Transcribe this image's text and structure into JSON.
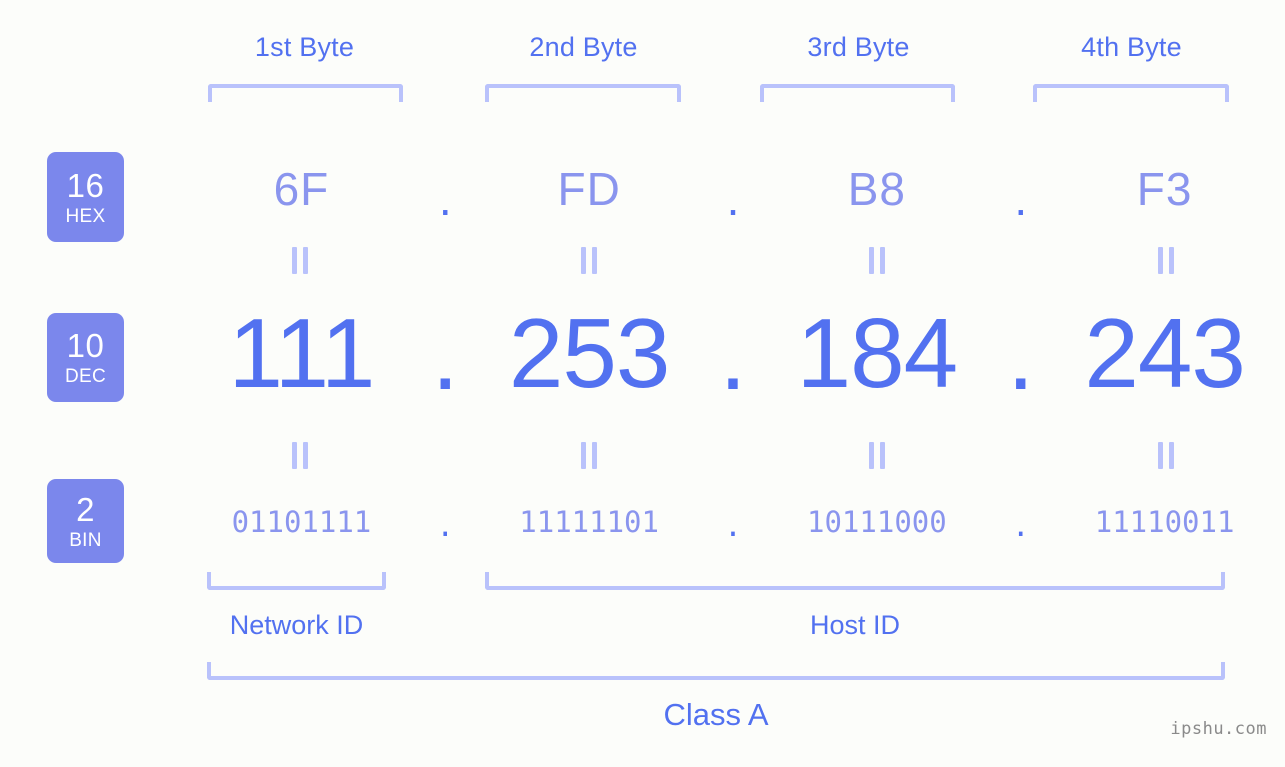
{
  "meta": {
    "background_color": "#fcfdfa",
    "accent_dark": "#5271f0",
    "accent_light": "#8a95ee",
    "accent_pale": "#b9c2fb",
    "badge_bg": "#7b87ec"
  },
  "byte_headers": [
    {
      "label": "1st Byte"
    },
    {
      "label": "2nd Byte"
    },
    {
      "label": "3rd Byte"
    },
    {
      "label": "4th Byte"
    }
  ],
  "radix_badges": [
    {
      "number": "16",
      "name": "HEX"
    },
    {
      "number": "10",
      "name": "DEC"
    },
    {
      "number": "2",
      "name": "BIN"
    }
  ],
  "rows": {
    "hex": {
      "values": [
        "6F",
        "FD",
        "B8",
        "F3"
      ],
      "separator": "."
    },
    "dec": {
      "values": [
        "111",
        "253",
        "184",
        "243"
      ],
      "separator": "."
    },
    "bin": {
      "values": [
        "01101111",
        "11111101",
        "10111000",
        "11110011"
      ],
      "separator": "."
    }
  },
  "equals_symbol": "=",
  "sections": {
    "network_id": "Network ID",
    "host_id": "Host ID",
    "class": "Class A"
  },
  "watermark": "ipshu.com"
}
